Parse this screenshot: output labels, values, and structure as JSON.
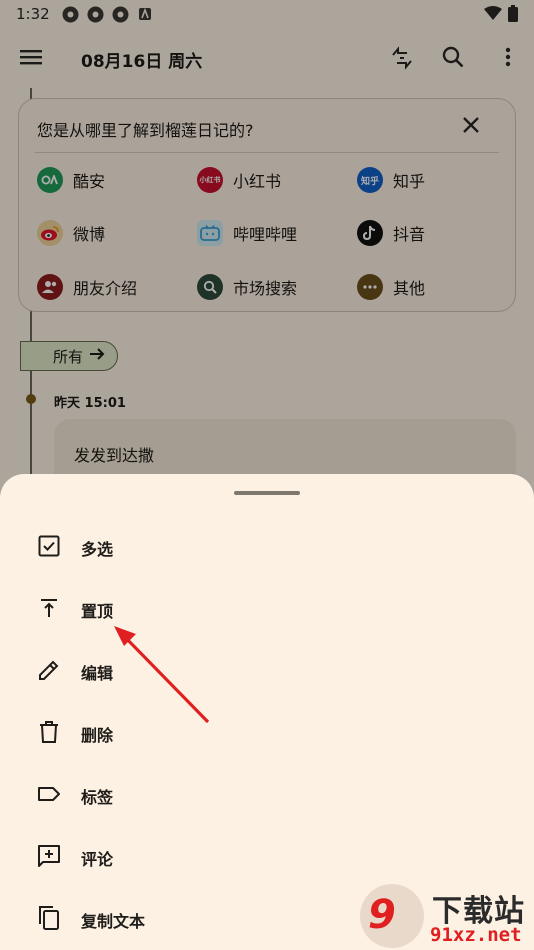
{
  "status_bar": {
    "time": "1:32"
  },
  "top_bar": {
    "title": "08月16日 周六"
  },
  "survey": {
    "question": "您是从哪里了解到榴莲日记的?",
    "options": [
      {
        "label": "酷安",
        "color": "#1f9b5a"
      },
      {
        "label": "小红书",
        "color": "#c8102e"
      },
      {
        "label": "知乎",
        "color": "#1060c8"
      },
      {
        "label": "微博",
        "color": "#e6a028"
      },
      {
        "label": "哔哩哔哩",
        "color": "#7fc6e0"
      },
      {
        "label": "抖音",
        "color": "#111111"
      },
      {
        "label": "朋友介绍",
        "color": "#8c1c1c"
      },
      {
        "label": "市场搜索",
        "color": "#2f4a3a"
      },
      {
        "label": "其他",
        "color": "#6b4e1a"
      }
    ],
    "logo_texts": {
      "xiaohongshu": "小红书",
      "zhihu": "知乎"
    }
  },
  "filter_chip": {
    "label": "所有"
  },
  "entry": {
    "time": "昨天 15:01",
    "text": "发发到达撒"
  },
  "sheet": {
    "items": [
      {
        "label": "多选",
        "icon": "checkbox-icon"
      },
      {
        "label": "置顶",
        "icon": "pin-top-icon"
      },
      {
        "label": "编辑",
        "icon": "pencil-icon"
      },
      {
        "label": "删除",
        "icon": "trash-icon"
      },
      {
        "label": "标签",
        "icon": "label-icon"
      },
      {
        "label": "评论",
        "icon": "comment-add-icon"
      },
      {
        "label": "复制文本",
        "icon": "copy-icon"
      }
    ]
  },
  "watermark": {
    "badge": "9",
    "title": "下载站",
    "domain": "91xz.net"
  },
  "colors": {
    "sheet_bg": "#fdf1e4",
    "annotation_arrow": "#e02020"
  }
}
